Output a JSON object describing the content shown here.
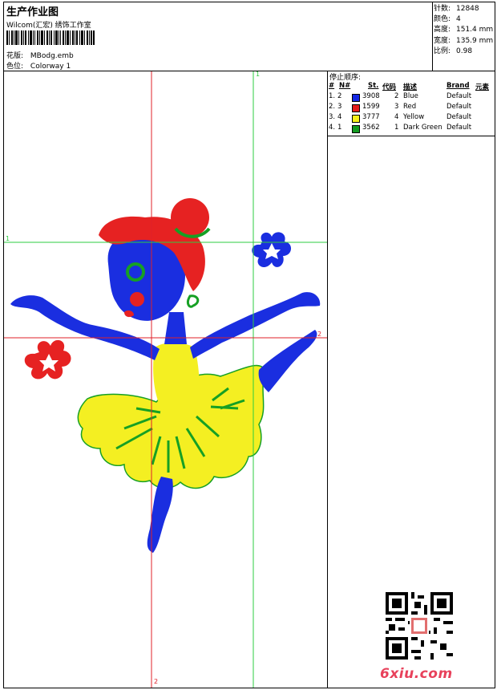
{
  "header": {
    "title": "生产作业图",
    "company": "Wilcom(汇宏) 绣饰工作室",
    "pattern_label": "花版:",
    "pattern_value": "MBodg.emb",
    "colorway_label": "色位:",
    "colorway_value": "Colorway 1"
  },
  "stats": [
    {
      "label": "针数:",
      "value": "12848"
    },
    {
      "label": "颜色:",
      "value": "4"
    },
    {
      "label": "高度:",
      "value": "151.4 mm"
    },
    {
      "label": "宽度:",
      "value": "135.9 mm"
    },
    {
      "label": "比例:",
      "value": "0.98"
    }
  ],
  "guides": {
    "top_marker": "1",
    "left_marker": "1",
    "right_marker": "2",
    "bottom_marker": "2",
    "guide_color_green": "#2ecc40",
    "guide_color_red": "#e0202a"
  },
  "stop_sequence": {
    "title": "停止顺序:",
    "headers": [
      "#",
      "N#",
      "St.",
      "代码",
      "描述",
      "Brand",
      "元素"
    ],
    "rows": [
      {
        "num": "1.",
        "n": "2",
        "st_color": "#1428e6",
        "code": "3908",
        "id": "2",
        "desc": "Blue",
        "brand": "Default"
      },
      {
        "num": "2.",
        "n": "3",
        "st_color": "#e51b1b",
        "code": "1599",
        "id": "3",
        "desc": "Red",
        "brand": "Default"
      },
      {
        "num": "3.",
        "n": "4",
        "st_color": "#f6f01a",
        "code": "3777",
        "id": "4",
        "desc": "Yellow",
        "brand": "Default"
      },
      {
        "num": "4.",
        "n": "1",
        "st_color": "#139b21",
        "code": "3562",
        "id": "1",
        "desc": "Dark Green",
        "brand": "Default"
      }
    ]
  },
  "design_colors": {
    "blue": "#1a2ee0",
    "red": "#e62222",
    "yellow": "#f4ef22",
    "green": "#16a024"
  },
  "watermark": "6xiu.com"
}
